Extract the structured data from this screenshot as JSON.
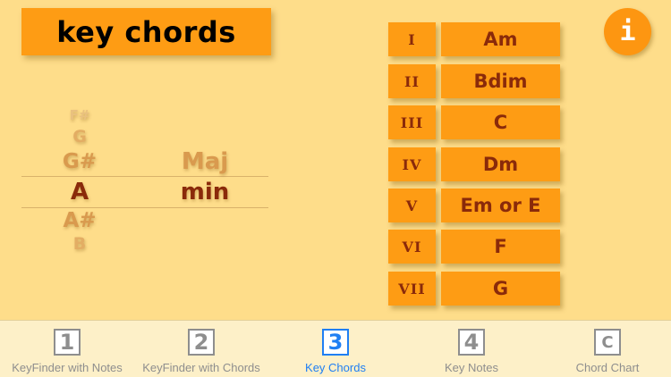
{
  "header": {
    "title": "key chords",
    "info_label": "i"
  },
  "picker": {
    "keys": [
      "F#",
      "G",
      "G#",
      "A",
      "A#",
      "B"
    ],
    "selected_key": "A",
    "modes": [
      "Maj",
      "min"
    ],
    "selected_mode": "min"
  },
  "chords": [
    {
      "degree": "I",
      "chord": "Am"
    },
    {
      "degree": "II",
      "chord": "Bdim"
    },
    {
      "degree": "III",
      "chord": "C"
    },
    {
      "degree": "IV",
      "chord": "Dm"
    },
    {
      "degree": "V",
      "chord": "Em or E"
    },
    {
      "degree": "VI",
      "chord": "F"
    },
    {
      "degree": "VII",
      "chord": "G"
    }
  ],
  "tabs": [
    {
      "icon": "1",
      "label": "KeyFinder with Notes"
    },
    {
      "icon": "2",
      "label": "KeyFinder with Chords"
    },
    {
      "icon": "3",
      "label": "Key Chords"
    },
    {
      "icon": "4",
      "label": "Key Notes"
    },
    {
      "icon": "C",
      "label": "Chord Chart"
    }
  ],
  "active_tab": "Key Chords",
  "colors": {
    "background": "#fedd8a",
    "button": "#fe9c14",
    "chord_text": "#8a2a0a",
    "tab_active": "#1f7ff3",
    "tab_inactive": "#8e8e8e"
  }
}
